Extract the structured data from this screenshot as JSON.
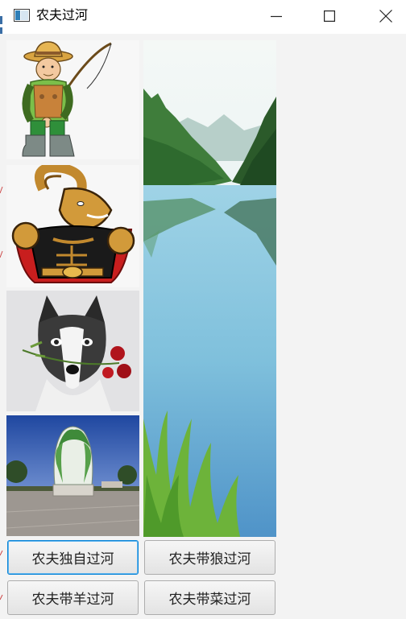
{
  "window": {
    "title": "农夫过河",
    "icon": "app-window-icon",
    "controls": [
      "minimize-icon",
      "maximize-icon",
      "close-icon"
    ]
  },
  "images": [
    {
      "name": "farmer-image",
      "depicts": "farmer-with-fishing-rod"
    },
    {
      "name": "goat-image",
      "depicts": "muscular-ram-mascot"
    },
    {
      "name": "wolf-image",
      "depicts": "husky-with-roses"
    },
    {
      "name": "cabbage-image",
      "depicts": "giant-cabbage-statue"
    },
    {
      "name": "river-image",
      "depicts": "river-landscape"
    }
  ],
  "buttons": {
    "farmer_alone": "农夫独自过河",
    "farmer_wolf": "农夫带狼过河",
    "farmer_goat": "农夫带羊过河",
    "farmer_cabbage": "农夫带菜过河"
  }
}
